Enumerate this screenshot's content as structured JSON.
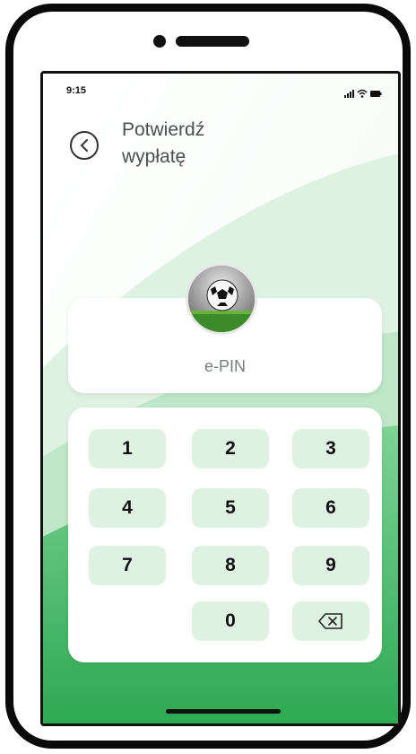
{
  "status_bar": {
    "time": "9:15"
  },
  "header": {
    "title_line1": "Potwierdź",
    "title_line2": "wypłatę"
  },
  "pin": {
    "label": "e-PIN"
  },
  "keypad": {
    "keys": [
      "1",
      "2",
      "3",
      "4",
      "5",
      "6",
      "7",
      "8",
      "9",
      "0"
    ],
    "backspace_icon": "backspace-icon"
  },
  "icons": {
    "back": "chevron-left-circle-icon",
    "avatar": "soccer-ball-icon",
    "signal": "signal-icon",
    "wifi": "wifi-icon",
    "battery": "battery-icon"
  },
  "colors": {
    "accent": "#3bb462",
    "key_bg": "#dff2e2",
    "title": "#4b4f52"
  }
}
